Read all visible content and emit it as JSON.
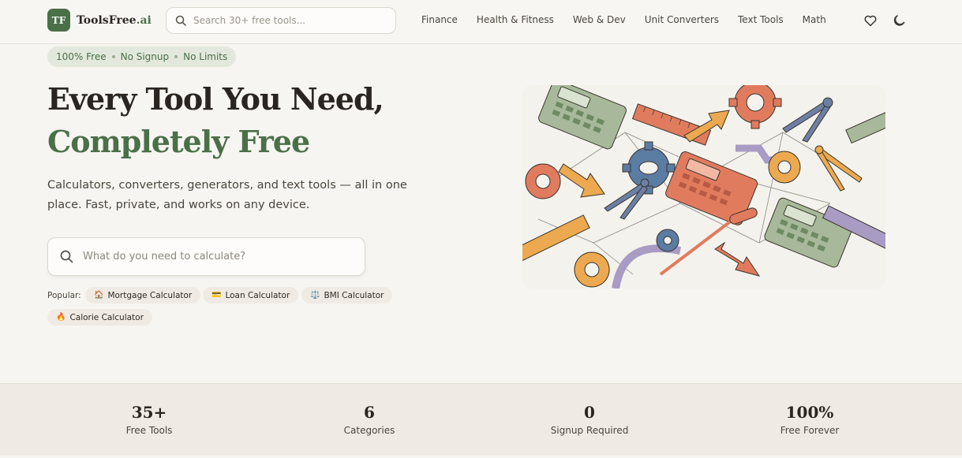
{
  "header": {
    "logo_mark": "TF",
    "brand_main": "ToolsFree",
    "brand_suffix": ".ai",
    "search_placeholder": "Search 30+ free tools...",
    "nav": [
      "Finance",
      "Health & Fitness",
      "Web & Dev",
      "Unit Converters",
      "Text Tools",
      "Math"
    ],
    "icons": [
      "heart-icon",
      "moon-icon"
    ]
  },
  "hero": {
    "badge": [
      "100% Free",
      "No Signup",
      "No Limits"
    ],
    "title_line1": "Every Tool You Need,",
    "title_line2": "Completely Free",
    "subtitle": "Calculators, converters, generators, and text tools — all in one place. Fast, private, and works on any device.",
    "search_placeholder": "What do you need to calculate?",
    "popular_label": "Popular:",
    "popular": [
      {
        "icon": "🏠",
        "label": "Mortgage Calculator"
      },
      {
        "icon": "💳",
        "label": "Loan Calculator"
      },
      {
        "icon": "⚖️",
        "label": "BMI Calculator"
      },
      {
        "icon": "🔥",
        "label": "Calorie Calculator"
      }
    ]
  },
  "stats": [
    {
      "value": "35+",
      "label": "Free Tools"
    },
    {
      "value": "6",
      "label": "Categories"
    },
    {
      "value": "0",
      "label": "Signup Required"
    },
    {
      "value": "100%",
      "label": "Free Forever"
    }
  ],
  "colors": {
    "brand_green": "#4a7048",
    "background": "#f7f5f1",
    "stats_band": "#efeae3"
  }
}
